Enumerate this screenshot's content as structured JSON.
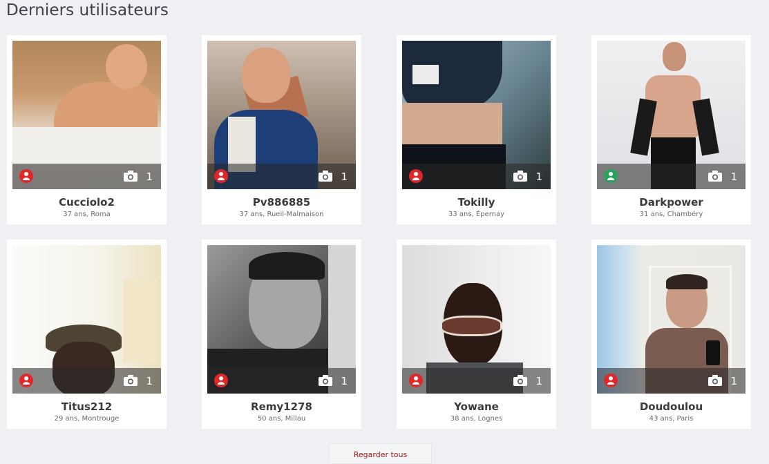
{
  "section_title": "Derniers utilisateurs",
  "users": [
    {
      "name": "Cucciolo2",
      "info": "37 ans, Roma",
      "photos": "1",
      "status": "offline"
    },
    {
      "name": "Pv886885",
      "info": "37 ans, Rueil-Malmaison",
      "photos": "1",
      "status": "offline"
    },
    {
      "name": "Tokilly",
      "info": "33 ans, Épernay",
      "photos": "1",
      "status": "offline"
    },
    {
      "name": "Darkpower",
      "info": "31 ans, Chambéry",
      "photos": "1",
      "status": "online"
    },
    {
      "name": "Titus212",
      "info": "29 ans, Montrouge",
      "photos": "1",
      "status": "offline"
    },
    {
      "name": "Remy1278",
      "info": "50 ans, Millau",
      "photos": "1",
      "status": "offline"
    },
    {
      "name": "Yowane",
      "info": "38 ans, Lognes",
      "photos": "1",
      "status": "offline"
    },
    {
      "name": "Doudoulou",
      "info": "43 ans, Paris",
      "photos": "1",
      "status": "offline"
    }
  ],
  "see_all_label": "Regarder tous",
  "colors": {
    "offline": "#e0272a",
    "online": "#27a55a",
    "link": "#a01a1a"
  }
}
